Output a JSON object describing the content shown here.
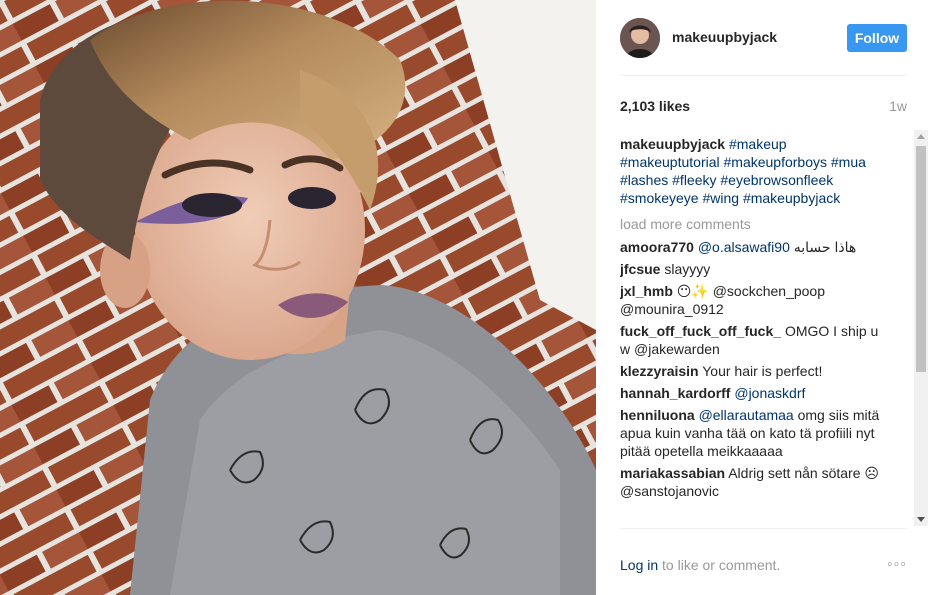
{
  "post": {
    "username": "makeuupbyjack",
    "follow_label": "Follow",
    "likes": "2,103 likes",
    "time_ago": "1w",
    "caption": {
      "user": "makeuupbyjack",
      "text": "#makeup #makeuptutorial #makeupforboys #mua #lashes #fleeky #eyebrowsonfleek #smokeyeye #wing #makeupbyjack"
    },
    "load_more": "load more comments",
    "comments": [
      {
        "user": "amoora770",
        "mention": "@o.alsawafi90",
        "text": " هاذا حسابه"
      },
      {
        "user": "jfcsue",
        "mention": "",
        "text": "slayyyy"
      },
      {
        "user": "jxl_hmb",
        "mention": "",
        "text": "😶✨ @sockchen_poop @mounira_0912"
      },
      {
        "user": "fuck_off_fuck_off_fuck_",
        "mention": "",
        "text": "OMGO I ship u w @jakewarden"
      },
      {
        "user": "klezzyraisin",
        "mention": "",
        "text": "Your hair is perfect!"
      },
      {
        "user": "hannah_kardorff",
        "mention": "@jonaskdrf",
        "text": ""
      },
      {
        "user": "henniluona",
        "mention": "@ellarautamaa",
        "text": " omg siis mitä apua kuin vanha tää on kato tä profiili nyt pitää opetella meikkaaaaa"
      },
      {
        "user": "mariakassabian",
        "mention": "",
        "text": "Aldrig sett nån sötare ☹ @sanstojanovic"
      }
    ],
    "footer": {
      "login_link": "Log in",
      "login_suffix": " to like or comment.",
      "more": "◦◦◦"
    }
  },
  "colors": {
    "accent": "#3897f0",
    "link": "#003569",
    "muted": "#999999"
  },
  "icons": {
    "avatar": "profile-photo",
    "more": "more-options-icon"
  }
}
